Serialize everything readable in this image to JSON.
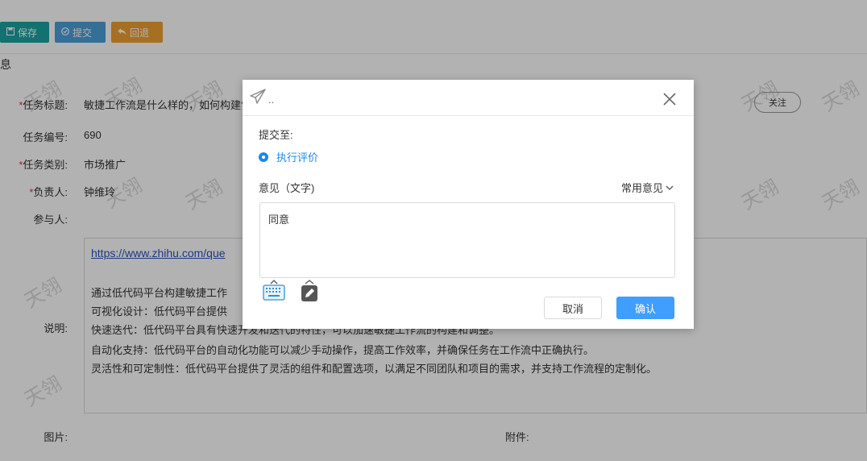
{
  "toolbar": {
    "save_label": "保存",
    "submit_label": "提交",
    "rollback_label": "回退",
    "save_color": "#1aa3a3",
    "submit_color": "#4a9fd8",
    "rollback_color": "#f0a030"
  },
  "section": {
    "title": "息"
  },
  "form": {
    "task_title_label": "任务标题:",
    "task_title_value": "敏捷工作流是什么样的，如何构建?",
    "task_no_label": "任务编号:",
    "task_no_value": "690",
    "task_type_label": "任务类别:",
    "task_type_value": "市场推广",
    "owner_label": "负责人:",
    "owner_value": "钟维玲",
    "participants_label": "参与人:",
    "desc_label": "说明:",
    "image_label": "图片:",
    "attachment_label": "附件:",
    "required_mark": "*",
    "follow_label": "关注"
  },
  "description": {
    "link": "https://www.zhihu.com/que",
    "lines": [
      "通过低代码平台构建敏捷工作",
      "可视化设计：低代码平台提供",
      "快速迭代：低代码平台具有快速开发和迭代的特性，可以加速敏捷工作流的构建和调整。",
      "自动化支持：低代码平台的自动化功能可以减少手动操作，提高工作效率，并确保任务在工作流中正确执行。",
      "灵活性和可定制性：低代码平台提供了灵活的组件和配置选项，以满足不同团队和项目的需求，并支持工作流程的定制化。"
    ]
  },
  "watermark": {
    "text": "天翎"
  },
  "modal": {
    "title_dots": "..",
    "submit_to_label": "提交至:",
    "option_label": "执行评价",
    "opinion_label": "意见（文字)",
    "common_opinion_label": "常用意见",
    "opinion_value": "同意",
    "cancel_label": "取消",
    "confirm_label": "确认",
    "accent_color": "#409eff"
  }
}
